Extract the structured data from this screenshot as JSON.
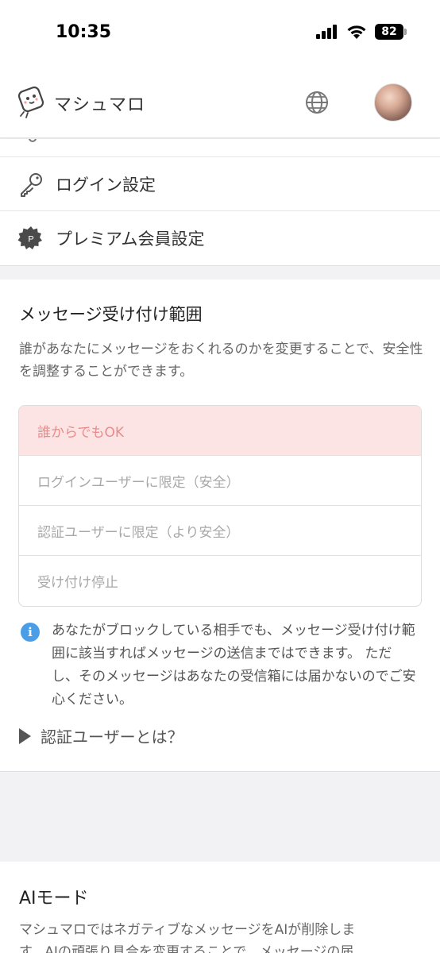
{
  "status_bar": {
    "time": "10:35",
    "battery": "82"
  },
  "header": {
    "app_name": "マシュマロ"
  },
  "menu": {
    "items": [
      {
        "label": "ログイン設定"
      },
      {
        "label": "プレミアム会員設定",
        "badge": "P"
      }
    ]
  },
  "message_range": {
    "title": "メッセージ受け付け範囲",
    "description": "誰があなたにメッセージをおくれるのかを変更することで、安全性を調整することができます。",
    "options": [
      {
        "label": "誰からでもOK",
        "selected": true
      },
      {
        "label": "ログインユーザーに限定（安全）",
        "selected": false
      },
      {
        "label": "認証ユーザーに限定（より安全）",
        "selected": false
      },
      {
        "label": "受け付け停止",
        "selected": false
      }
    ],
    "info_icon": "i",
    "info_text": "あなたがブロックしている相手でも、メッセージ受け付け範囲に該当すればメッセージの送信まではできます。 ただし、そのメッセージはあなたの受信箱には届かないのでご安心ください。",
    "disclosure_label": "認証ユーザーとは？"
  },
  "ai_mode": {
    "title": "AIモード",
    "description_line1": "マシュマロではネガティブなメッセージをAIが削除しま",
    "description_line2": "す。AIの頑張り具合を変更することで、メッセージの届"
  },
  "colors": {
    "selected_bg": "#fde4e4",
    "selected_text": "#e88b8b",
    "info_blue": "#4a9ee8"
  }
}
